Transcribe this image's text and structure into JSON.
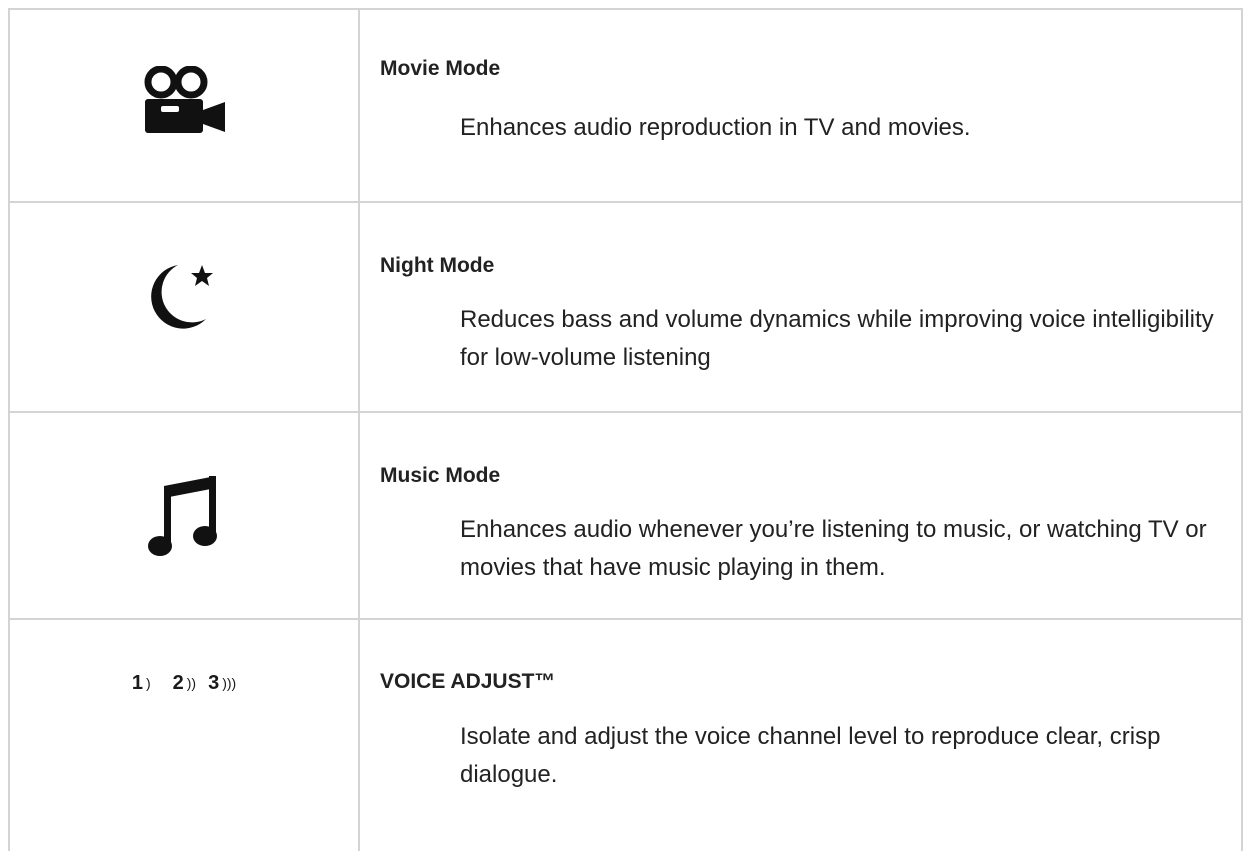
{
  "modes": [
    {
      "icon": "movie-camera-icon",
      "title": "Movie Mode",
      "description": "Enhances audio reproduction in TV and movies."
    },
    {
      "icon": "moon-star-icon",
      "title": "Night Mode",
      "description": "Reduces bass and volume dynamics while improving voice intelligibility for low-volume listening"
    },
    {
      "icon": "music-note-icon",
      "title": "Music Mode",
      "description": "Enhances audio whenever you’re listening to music, or watching TV or movies that have music playing in them."
    },
    {
      "icon": "voice-levels-icon",
      "title": "VOICE ADJUST™",
      "description": "Isolate and adjust the voice channel level to reproduce clear, crisp dialogue."
    }
  ],
  "voice_levels": [
    {
      "num": "1",
      "waves": ")"
    },
    {
      "num": "2",
      "waves": "))"
    },
    {
      "num": "3",
      "waves": ")))"
    }
  ]
}
